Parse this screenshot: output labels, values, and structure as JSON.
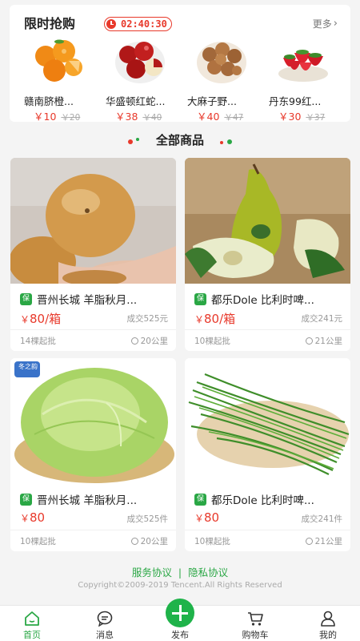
{
  "flash_sale": {
    "title": "限时抢购",
    "countdown": "02:40:30",
    "more_label": "更多",
    "items": [
      {
        "name": "赣南脐橙...",
        "price": "￥10",
        "old_price": "￥20"
      },
      {
        "name": "华盛顿红蛇...",
        "price": "￥38",
        "old_price": "￥40"
      },
      {
        "name": "大麻子野...",
        "price": "￥40",
        "old_price": "￥47"
      },
      {
        "name": "丹东99红...",
        "price": "￥30",
        "old_price": "￥37"
      }
    ]
  },
  "all_products": {
    "title": "全部商品",
    "colors": {
      "red": "#e8392b",
      "green": "#2aa745"
    }
  },
  "products": [
    {
      "badge": "保",
      "name": "晋州长城 羊脂秋月...",
      "price": "80",
      "unit": "/箱",
      "currency": "￥",
      "sold": "成交525元",
      "min_order": "14棵起批",
      "distance": "20公里"
    },
    {
      "badge": "保",
      "name": "都乐Dole 比利时啤...",
      "price": "80",
      "unit": "/箱",
      "currency": "￥",
      "sold": "成交241元",
      "min_order": "10棵起批",
      "distance": "21公里"
    },
    {
      "badge": "保",
      "name": "晋州长城 羊脂秋月...",
      "price": "80",
      "unit": "",
      "currency": "￥",
      "sold": "成交525件",
      "min_order": "10棵起批",
      "distance": "20公里",
      "corner_tag": "冬之韵"
    },
    {
      "badge": "保",
      "name": "都乐Dole 比利时啤...",
      "price": "80",
      "unit": "",
      "currency": "￥",
      "sold": "成交241件",
      "min_order": "10棵起批",
      "distance": "21公里"
    }
  ],
  "footer": {
    "service_agreement": "服务协议",
    "separator": "|",
    "privacy_agreement": "隐私协议",
    "copyright": "Copyright©2009-2019  Tencent.All Rights Reserved"
  },
  "tabbar": {
    "items": [
      {
        "label": "首页",
        "icon": "home-icon",
        "active": true
      },
      {
        "label": "消息",
        "icon": "message-icon"
      },
      {
        "label": "发布",
        "icon": "plus-icon"
      },
      {
        "label": "购物车",
        "icon": "cart-icon"
      },
      {
        "label": "我的",
        "icon": "user-icon"
      }
    ],
    "accent": "#2aa745"
  }
}
